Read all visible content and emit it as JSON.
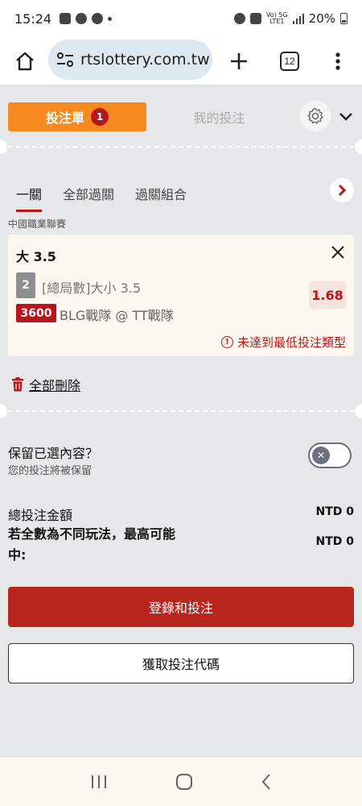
{
  "status_bar": {
    "time": "15:24",
    "network_small_top": "Vo) 5G",
    "network_small_bottom": "LTE1",
    "battery": "20%"
  },
  "browser": {
    "url": "rtslottery.com.tw",
    "tab_count": "12"
  },
  "slip": {
    "tab_betslip": "投注單",
    "betslip_count": "1",
    "tab_my_bets": "我的投注",
    "type_tabs": [
      "一關",
      "全部過關",
      "過關組合"
    ],
    "league": "中國職業聯賽",
    "bet": {
      "selection": "大 3.5",
      "number": "2",
      "market": "[總局數]大小 3.5",
      "odds": "1.68",
      "game_code": "3600",
      "match": "BLG戰隊 @ TT戰隊",
      "warning": "未達到最低投注類型"
    },
    "delete_all": "全部刪除",
    "keep_title": "保留已選內容？",
    "keep_subtitle": "您的投注將被保留",
    "total_label": "總投注金額",
    "total_value": "NTD 0",
    "potential_label": "若全數為不同玩法，最高可能中:",
    "potential_value": "NTD 0",
    "primary_button": "登錄和投注",
    "secondary_button": "獲取投注代碼"
  },
  "colors": {
    "accent_orange": "#f68a1e",
    "brand_red": "#b8161d",
    "background": "#e6e7e9",
    "card": "#fdf8ef"
  }
}
